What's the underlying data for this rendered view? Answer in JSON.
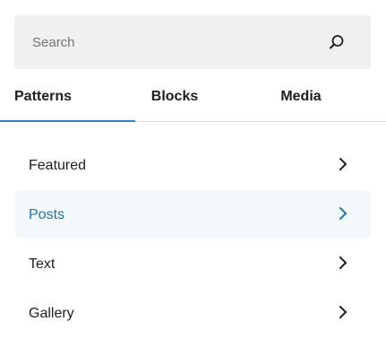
{
  "search": {
    "placeholder": "Search",
    "value": "",
    "icon": "search-icon"
  },
  "tabs": [
    {
      "label": "Patterns",
      "selected": true
    },
    {
      "label": "Blocks",
      "selected": false
    },
    {
      "label": "Media",
      "selected": false
    }
  ],
  "categories": [
    {
      "label": "Featured",
      "active": false,
      "icon": "chevron-right-icon"
    },
    {
      "label": "Posts",
      "active": true,
      "icon": "chevron-right-icon"
    },
    {
      "label": "Text",
      "active": false,
      "icon": "chevron-right-icon"
    },
    {
      "label": "Gallery",
      "active": false,
      "icon": "chevron-right-icon"
    }
  ],
  "colors": {
    "accent": "#2271b1",
    "tab_indicator": "#3582c4",
    "active_row_bg": "#f2f8fc",
    "search_bg": "#f0f0f0"
  }
}
